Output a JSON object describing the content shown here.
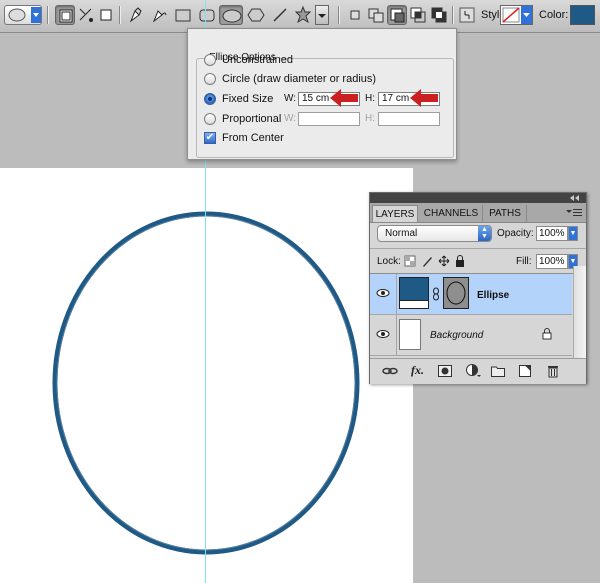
{
  "toolbar": {
    "style_label": "Style:",
    "color_label": "Color:",
    "color_value": "#1e5a85",
    "tools": [
      "ellipse-preset-picker",
      "shape-layers",
      "paths",
      "fill-pixels",
      "pen",
      "freeform-pen",
      "rectangle",
      "rounded-rectangle",
      "ellipse",
      "polygon",
      "line",
      "custom-shape",
      "geometry-options",
      "new-shape-area",
      "add-to-shape-area",
      "subtract-from-shape-area",
      "intersect-shape-areas",
      "exclude-overlapping",
      "link-style"
    ]
  },
  "ellipse_options": {
    "title": "Ellipse Options",
    "unconstrained": "Unconstrained",
    "circle": "Circle (draw diameter or radius)",
    "fixed_size": "Fixed Size",
    "proportional": "Proportional",
    "from_center": "From Center",
    "w_label": "W:",
    "h_label": "H:",
    "w_value": "15 cm",
    "h_value": "17 cm",
    "selected": "fixed_size",
    "from_center_checked": true
  },
  "layers_panel": {
    "tabs": [
      "LAYERS",
      "CHANNELS",
      "PATHS"
    ],
    "active_tab": "LAYERS",
    "blend_mode": "Normal",
    "opacity_label": "Opacity:",
    "opacity_value": "100%",
    "lock_label": "Lock:",
    "fill_label": "Fill:",
    "fill_value": "100%",
    "layers": [
      {
        "name": "Ellipse",
        "selected": true,
        "color": "#1e5a85"
      },
      {
        "name": "Background",
        "selected": false,
        "color": "#ffffff"
      }
    ],
    "footer_icons": [
      "link-layers-icon",
      "fx-icon",
      "add-mask-icon",
      "adjustment-layer-icon",
      "new-group-icon",
      "new-layer-icon",
      "trash-icon"
    ]
  },
  "canvas": {
    "shape_stroke_color": "#1e5a85",
    "guide_color": "#7fe3f3"
  },
  "accent_colors": {
    "arrow_red": "#cc1f1f",
    "selected_layer": "#b4d3fb"
  }
}
